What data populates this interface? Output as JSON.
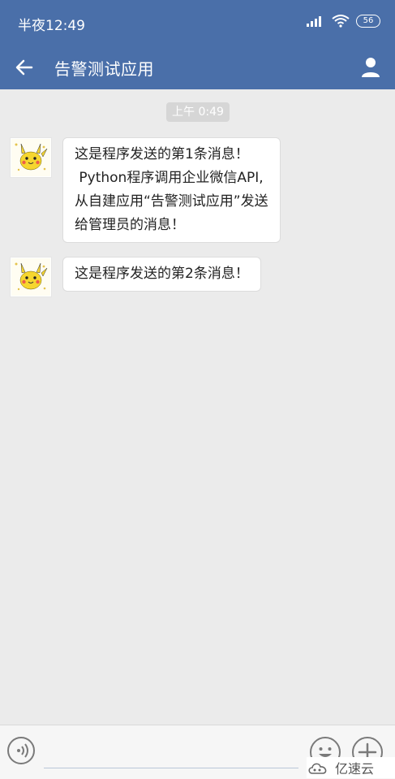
{
  "status_bar": {
    "time": "半夜12:49",
    "battery": "56",
    "icons": [
      "signal-icon",
      "wifi-icon",
      "battery-icon"
    ]
  },
  "header": {
    "title": "告警测试应用",
    "left_icon": "back-arrow-icon",
    "right_icon": "profile-icon"
  },
  "chat": {
    "timestamp": "上午 0:49",
    "messages": [
      {
        "avatar": "pikachu-avatar",
        "text": "这是程序发送的第1条消息！\n Python程序调用企业微信API,\n从自建应用“告警测试应用”发送\n给管理员的消息！"
      },
      {
        "avatar": "pikachu-avatar",
        "text": "这是程序发送的第2条消息！"
      }
    ]
  },
  "input_bar": {
    "voice_icon": "voice-icon",
    "emoji_icon": "emoji-icon",
    "plus_icon": "plus-icon"
  },
  "watermark": {
    "text": "亿速云"
  },
  "colors": {
    "header": "#4a6fa9",
    "background": "#ebebeb"
  }
}
